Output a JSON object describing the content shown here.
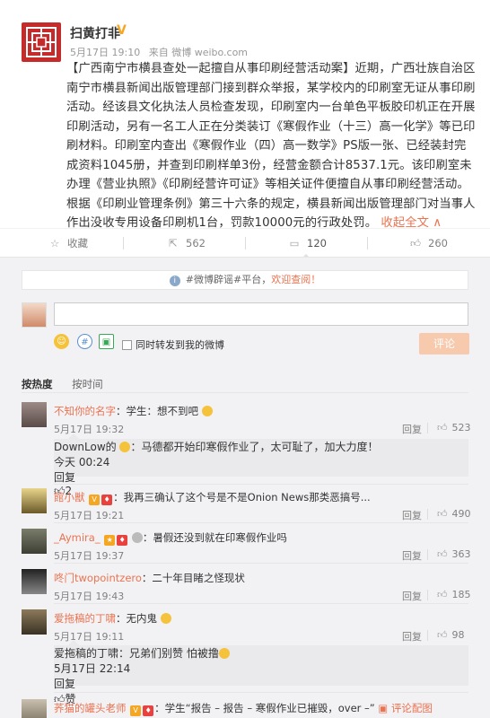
{
  "post": {
    "author": "扫黄打非",
    "verified_mark": "V",
    "date": "5月17日 19:10",
    "source": "来自 微博 weibo.com",
    "body": "【广西南宁市横县查处一起擅自从事印刷经营活动案】近期，广西壮族自治区南宁市横县新闻出版管理部门接到群众举报，某学校内的印刷室无证从事印刷活动。经该县文化执法人员检查发现，印刷室内一台单色平板胶印机正在开展印刷活动，另有一名工人正在分类装订《寒假作业（十三）高一化学》等已印刷材料。印刷室内查出《寒假作业（四）高一数学》PS版一张、已经装封完成资料1045册，并查到印刷样单3份，经营金额合计8537.1元。该印刷室未办理《营业执照》《印刷经营许可证》等相关证件便擅自从事印刷经营活动。根据《印刷业管理条例》第三十六条的规定，横县新闻出版管理部门对当事人作出没收专用设备印刷机1台，罚款10000元的行政处罚。",
    "collapse_label": "收起全文 ∧"
  },
  "actions": {
    "favorite": "收藏",
    "share": "562",
    "comment": "120",
    "like": "260"
  },
  "comment_box": {
    "notice_prefix": "#微博辟谣#平台，",
    "notice_link": "欢迎查阅！",
    "forward_label": "同时转发到我的微博",
    "submit_label": "评论"
  },
  "sort": {
    "hot": "按热度",
    "time": "按时间"
  },
  "comments": [
    {
      "name": "不知你的名字",
      "text": "：学生：想不到吧",
      "time": "5月17日 19:32",
      "reply": "回复",
      "likes": "523"
    },
    {
      "name": "DownLow的",
      "text": "：马德都开始印寒假作业了，太可耻了，加大力度！",
      "time": "今天 00:24",
      "reply": "回复",
      "likes": "2"
    },
    {
      "name": "館小獣",
      "text": "：我再三确认了这个号是不是Onion News那类恶搞号...",
      "time": "5月17日 19:21",
      "reply": "回复",
      "likes": "490"
    },
    {
      "name": "_Aymira_",
      "text": "：暑假还没到就在印寒假作业吗",
      "time": "5月17日 19:37",
      "reply": "回复",
      "likes": "363"
    },
    {
      "name": "咚门twopointzero",
      "text": "：二十年目睹之怪现状",
      "time": "5月17日 19:43",
      "reply": "回复",
      "likes": "185"
    },
    {
      "name": "爱拖稿的丁啸",
      "text": "：无内鬼",
      "time": "5月17日 19:11",
      "reply": "回复",
      "likes": "98"
    },
    {
      "name": "爱拖稿的丁啸",
      "text": "：兄弟们别赞 怕被撸",
      "time": "5月17日 22:14",
      "reply": "回复",
      "likes": "赞"
    },
    {
      "name": "荞猫的罐头老师",
      "text": "：学生“报告 – 报告 – 寒假作业已摧毁，over –”",
      "time": "",
      "reply": "",
      "likes": "",
      "extra": "评论配图"
    }
  ]
}
